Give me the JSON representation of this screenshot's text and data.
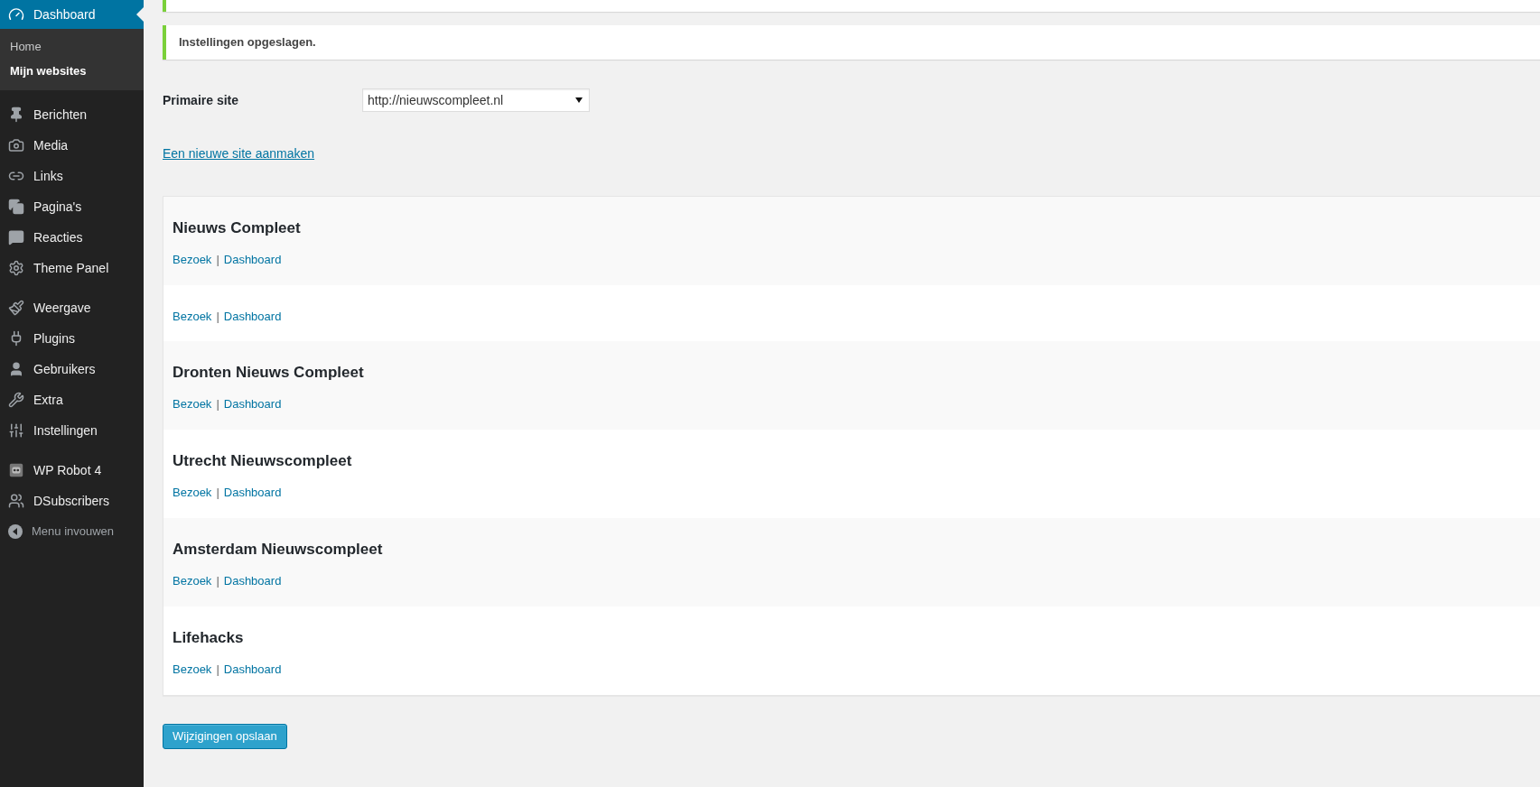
{
  "sidebar": {
    "sections": [
      {
        "items": [
          {
            "label": "Dashboard",
            "selected": true,
            "children": [
              {
                "label": "Home",
                "selected": false
              },
              {
                "label": "Mijn websites",
                "selected": true
              }
            ]
          }
        ]
      },
      {
        "items": [
          {
            "label": "Berichten",
            "selected": false
          },
          {
            "label": "Media",
            "selected": false
          },
          {
            "label": "Links",
            "selected": false
          },
          {
            "label": "Pagina's",
            "selected": false
          },
          {
            "label": "Reacties",
            "selected": false
          },
          {
            "label": "Theme Panel",
            "selected": false
          }
        ]
      },
      {
        "items": [
          {
            "label": "Weergave",
            "selected": false
          },
          {
            "label": "Plugins",
            "selected": false
          },
          {
            "label": "Gebruikers",
            "selected": false
          },
          {
            "label": "Extra",
            "selected": false
          },
          {
            "label": "Instellingen",
            "selected": false
          }
        ]
      },
      {
        "items": [
          {
            "label": "WP Robot 4",
            "selected": false
          },
          {
            "label": "DSubscribers",
            "selected": false
          }
        ]
      }
    ],
    "collapse_button": {
      "label": "Menu invouwen"
    }
  },
  "notice": {
    "text": "Instellingen opgeslagen."
  },
  "primary_site": {
    "label": "Primaire site",
    "value": "http://nieuwscompleet.nl"
  },
  "new_site_link": "Een nieuwe site aanmaken",
  "sites": [
    {
      "title": "Nieuws Compleet",
      "actions": [
        "Bezoek",
        "Dashboard"
      ],
      "divider": "|"
    },
    {
      "actions": [
        "Bezoek",
        "Dashboard"
      ],
      "divider": "|"
    },
    {
      "title": "Dronten Nieuws Compleet",
      "actions": [
        "Bezoek",
        "Dashboard"
      ],
      "divider": "|"
    },
    {
      "title": "Utrecht Nieuwscompleet",
      "actions": [
        "Bezoek",
        "Dashboard"
      ],
      "divider": "|"
    },
    {
      "title": "Amsterdam Nieuwscompleet",
      "actions": [
        "Bezoek",
        "Dashboard"
      ],
      "divider": "|"
    },
    {
      "title": "Lifehacks",
      "actions": [
        "Bezoek",
        "Dashboard"
      ],
      "divider": "|"
    }
  ],
  "save_button": "Wijzigingen opslaan"
}
